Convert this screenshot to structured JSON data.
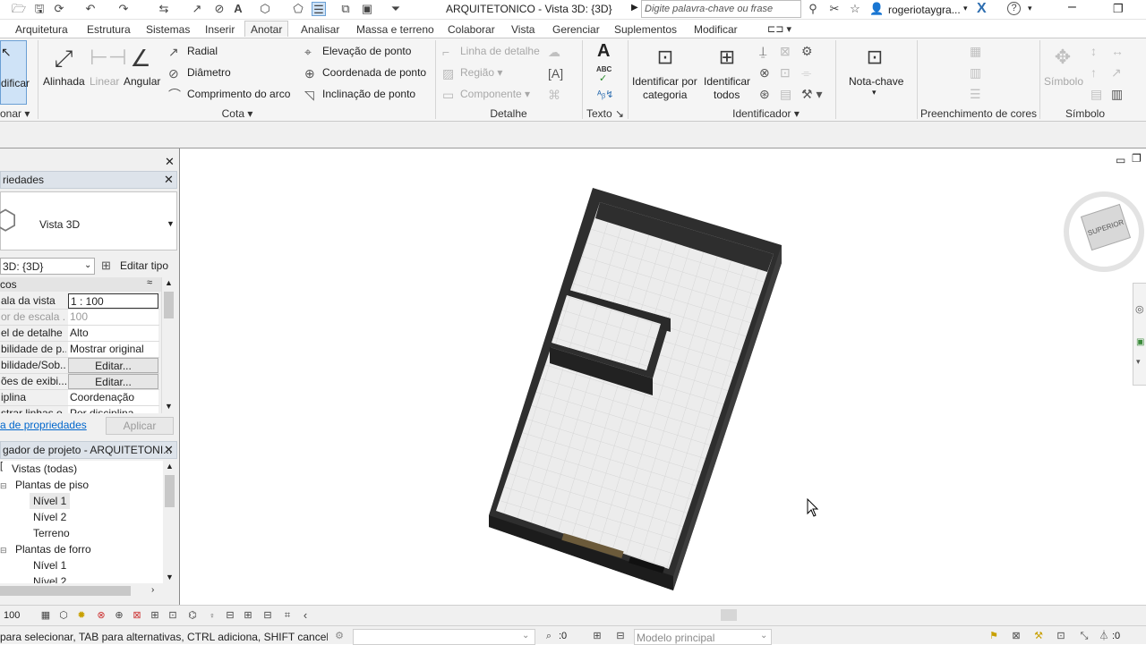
{
  "titlebar": {
    "title": "ARQUITETONICO - Vista 3D: {3D}",
    "search_placeholder": "Digite palavra-chave ou frase",
    "user": "rogeriotaygra...",
    "x_icon": "X"
  },
  "tabs": [
    "Arquitetura",
    "Estrutura",
    "Sistemas",
    "Inserir",
    "Anotar",
    "Analisar",
    "Massa e terreno",
    "Colaborar",
    "Vista",
    "Gerenciar",
    "Suplementos",
    "Modificar"
  ],
  "active_tab": "Anotar",
  "ribbon": {
    "modify": {
      "label": "dificar",
      "footer": "onar"
    },
    "dim": {
      "aligned": "Alinhada",
      "linear": "Linear",
      "angular": "Angular",
      "radial": "Radial",
      "diameter": "Diâmetro",
      "arc_length": "Comprimento  do arco",
      "spot_elevation": "Elevação  de ponto",
      "spot_coordinate": "Coordenada  de ponto",
      "spot_slope": "Inclinação  de ponto",
      "footer": "Cota"
    },
    "detail": {
      "detail_line": "Linha de  detalhe",
      "region": "Região",
      "component": "Componente",
      "footer": "Detalhe"
    },
    "text": {
      "glyph": "A",
      "abc": "ABC",
      "footer": "Texto"
    },
    "tag": {
      "by_category_1": "Identificar por",
      "by_category_2": "categoria",
      "tag_all_1": "Identificar",
      "tag_all_2": "todos",
      "footer": "Identificador"
    },
    "keynote": {
      "label": "Nota-chave"
    },
    "color_fill": {
      "footer": "Preenchimento de cores"
    },
    "symbol": {
      "label": "Símbolo",
      "footer": "Símbolo"
    }
  },
  "properties": {
    "header": "riedades",
    "type_name": "Vista 3D",
    "selector_value": "3D: {3D}",
    "edit_type": "Editar tipo",
    "group": "cos",
    "rows": [
      {
        "k": "ala da vista",
        "v": "1 : 100"
      },
      {
        "k": "or de escala ...",
        "v": "100"
      },
      {
        "k": "el de detalhe",
        "v": "Alto"
      },
      {
        "k": "bilidade de p...",
        "v": "Mostrar original"
      },
      {
        "k": "bilidade/Sob...",
        "v": "Editar..."
      },
      {
        "k": "ões de exibi...",
        "v": "Editar..."
      },
      {
        "k": "iplina",
        "v": "Coordenação"
      },
      {
        "k": "strar linhas o...",
        "v": "Por disciplina"
      }
    ],
    "help_link": "a de propriedades",
    "apply": "Aplicar"
  },
  "browser": {
    "header": "gador de projeto - ARQUITETONI...",
    "items": [
      {
        "label": "Vistas (todas)"
      },
      {
        "label": "Plantas de piso"
      },
      {
        "label": "Nível 1"
      },
      {
        "label": "Nível 2"
      },
      {
        "label": "Terreno"
      },
      {
        "label": "Plantas de forro"
      },
      {
        "label": "Nível 1"
      },
      {
        "label": "Nível 2"
      }
    ]
  },
  "viewcube": {
    "face": "SUPERIOR"
  },
  "viewbar": {
    "scale": "100"
  },
  "status": {
    "hint": "para selecionar, TAB para alternativas, CTRL adiciona, SHIFT cancela a",
    "count1": ":0",
    "model": "Modelo principal",
    "filter_count": ":0"
  },
  "colors": {
    "wall": "#2e2e2e",
    "floor": "#e9e9e9",
    "panel_title": "#dde3ea",
    "ribbon_bg": "#f5f5f5",
    "link": "#0066cc"
  }
}
